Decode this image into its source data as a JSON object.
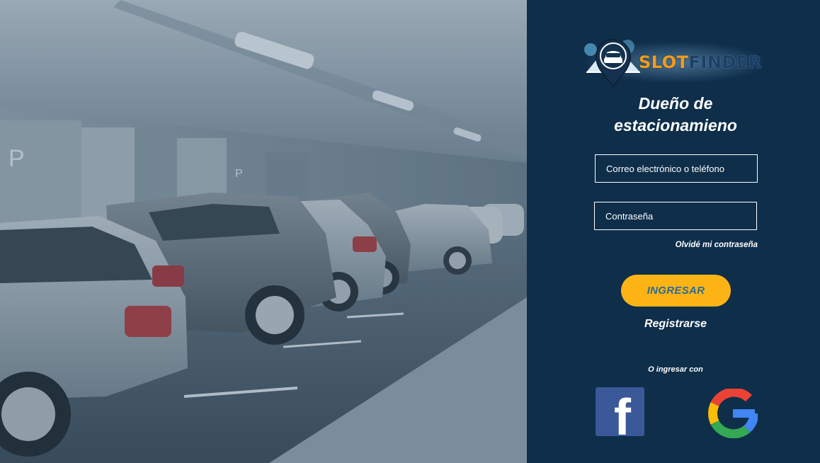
{
  "background": {
    "description_icon": "parking-garage-photo"
  },
  "brand": {
    "slot": "SLOT",
    "finder": "FINDER",
    "colors": {
      "slot": "#f39a1c",
      "finder": "#1c3f66",
      "pin": "#14324f"
    }
  },
  "title": {
    "line1": "Dueño de",
    "line2": "estacionamieno"
  },
  "form": {
    "email_placeholder": "Correo electrónico o teléfono",
    "password_placeholder": "Contraseña",
    "forgot_label": "Olvidé mi contraseña",
    "login_label": "INGRESAR",
    "register_label": "Registrarse"
  },
  "social": {
    "label": "O ingresar con",
    "facebook_letter": "f",
    "facebook_icon": "facebook-icon",
    "google_icon": "google-icon"
  },
  "colors": {
    "panel": "#0e2e4a",
    "button": "#fcb415",
    "button_text": "#2b6a98",
    "facebook": "#3b5998"
  }
}
